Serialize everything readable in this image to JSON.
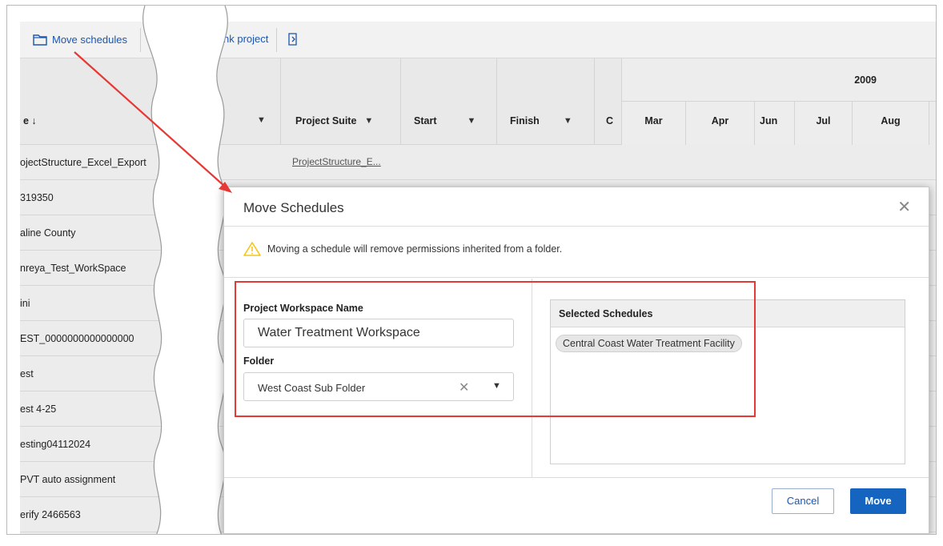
{
  "toolbar": {
    "move_schedules": "Move schedules",
    "link_project_partial": "nk project"
  },
  "grid": {
    "headers": {
      "name_partial": "e ↓",
      "project_suite": "Project Suite",
      "start": "Start",
      "finish": "Finish",
      "c_partial": "C"
    },
    "rows": [
      {
        "name": "ojectStructure_Excel_Export",
        "suite": "ProjectStructure_E..."
      },
      {
        "name": "319350"
      },
      {
        "name": "aline County"
      },
      {
        "name": "nreya_Test_WorkSpace"
      },
      {
        "name": "ini"
      },
      {
        "name": "EST_0000000000000000"
      },
      {
        "name": "est"
      },
      {
        "name": "est 4-25"
      },
      {
        "name": "esting04112024"
      },
      {
        "name": "PVT auto assignment"
      },
      {
        "name": "erify 2466563"
      }
    ],
    "timeline": {
      "year": "2009",
      "months": [
        "Mar",
        "Apr",
        "Jun",
        "Jul",
        "Aug"
      ]
    }
  },
  "dialog": {
    "title": "Move Schedules",
    "close_icon": "close-icon",
    "warning_text": "Moving a schedule will remove permissions inherited from a folder.",
    "workspace_label": "Project Workspace Name",
    "workspace_value": "Water Treatment Workspace",
    "folder_label": "Folder",
    "folder_value": "West Coast Sub Folder",
    "selected_header": "Selected Schedules",
    "selected_items": [
      "Central Coast Water Treatment Facility"
    ],
    "cancel_label": "Cancel",
    "move_label": "Move"
  },
  "colors": {
    "accent": "#1565c0",
    "annotation": "#e53935",
    "warning": "#f5c518"
  }
}
